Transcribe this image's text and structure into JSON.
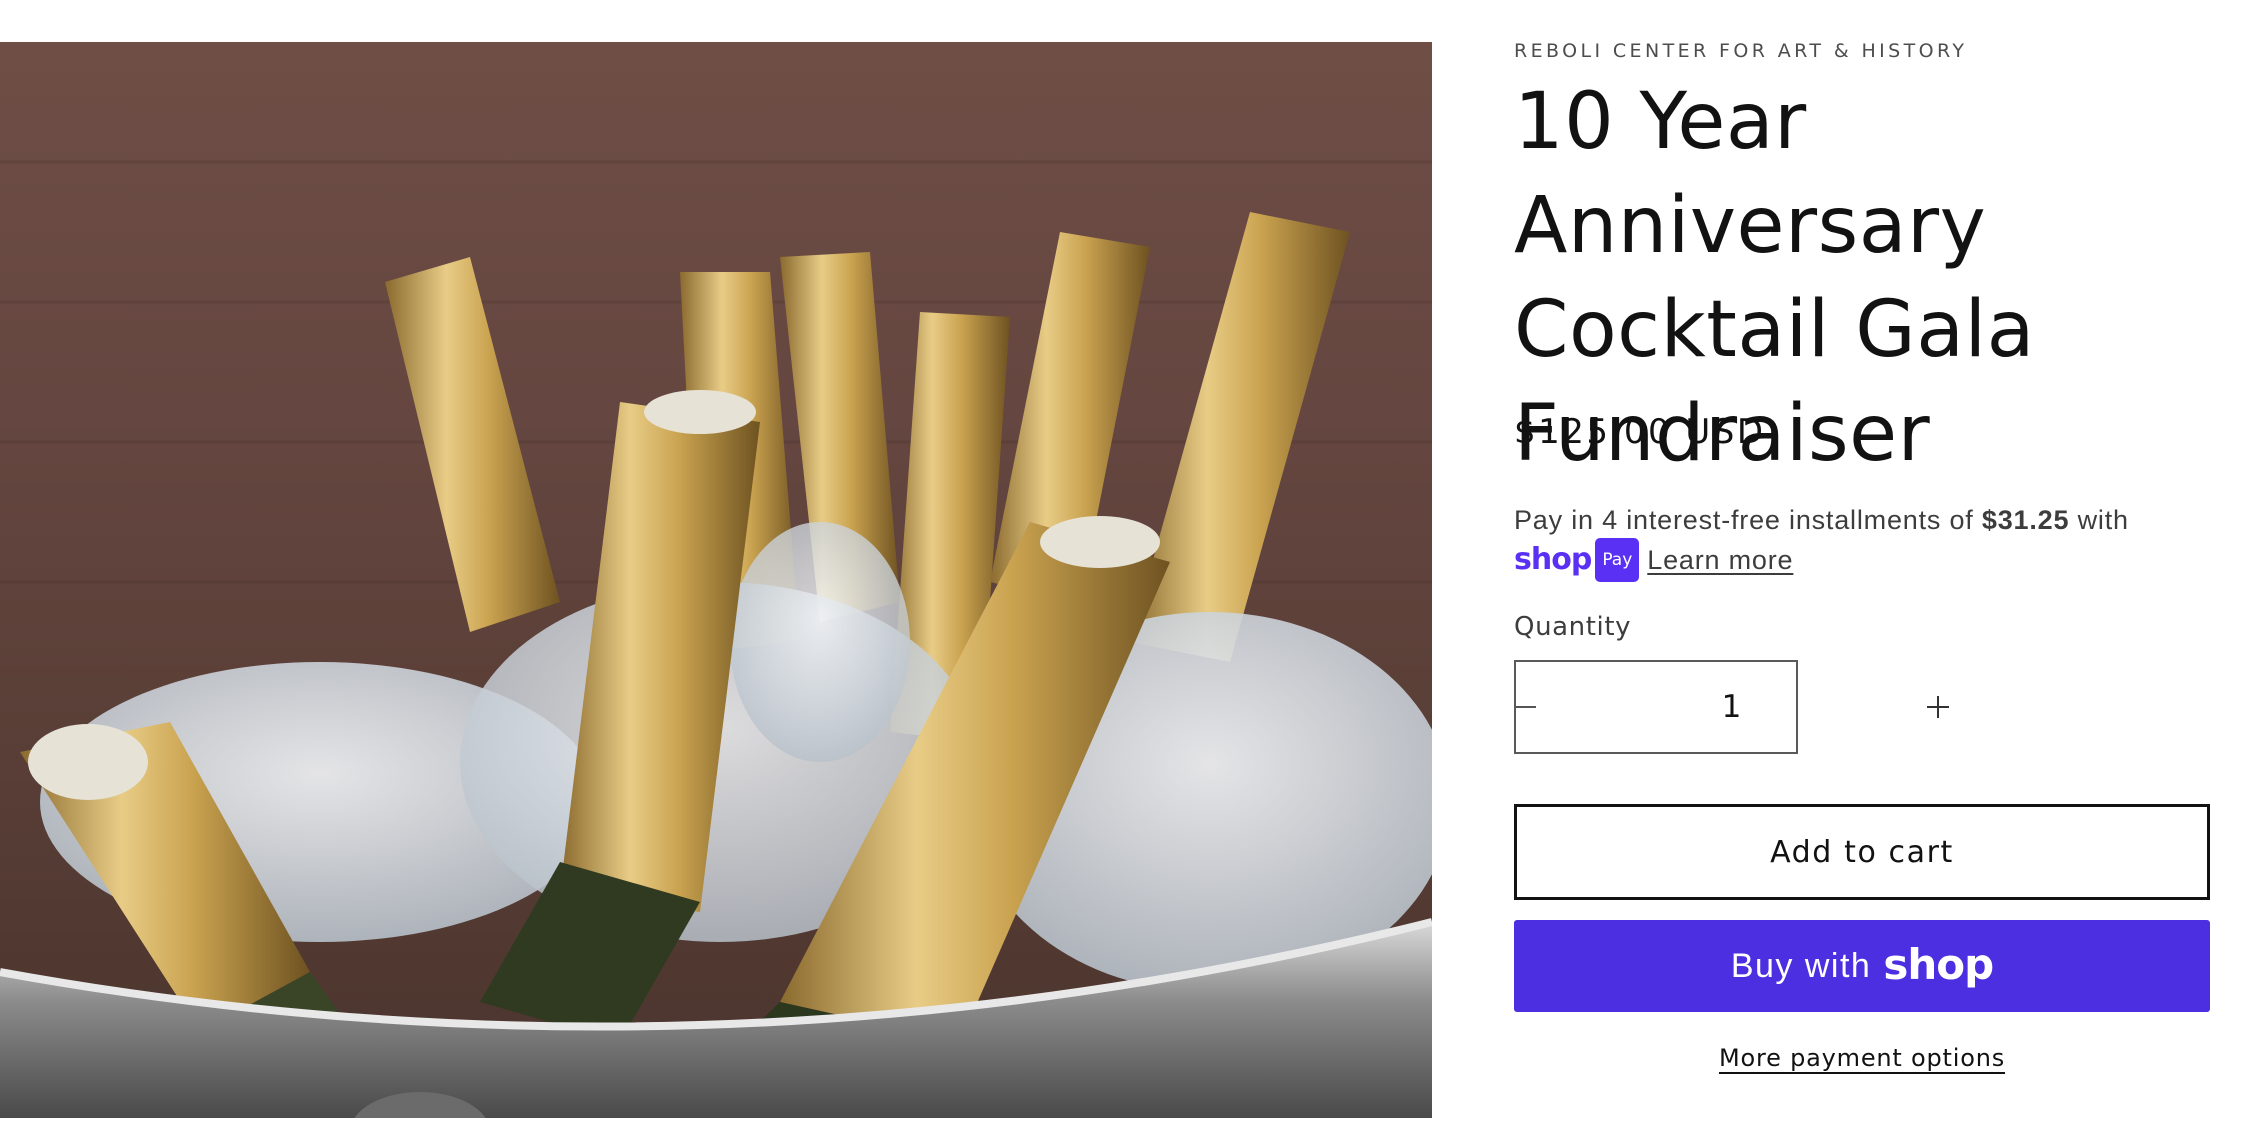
{
  "product": {
    "vendor": "REBOLI CENTER FOR ART & HISTORY",
    "title": "10 Year Anniversary Cocktail Gala Fundraiser",
    "price": "$125.00 USD",
    "image_alt": "champagne-bottles-in-ice-bucket"
  },
  "installments": {
    "prefix": "Pay in 4 interest-free installments of",
    "amount": "$31.25",
    "suffix": "with",
    "logo_text": "shop",
    "logo_badge": "Pay",
    "learn_more": "Learn more"
  },
  "quantity": {
    "label": "Quantity",
    "value": "1",
    "minus_icon": "minus-icon",
    "plus_icon": "plus-icon"
  },
  "actions": {
    "add_to_cart": "Add to cart",
    "buy_with": "Buy with",
    "buy_brand": "shop",
    "more_payment": "More payment options"
  },
  "colors": {
    "shop_pay_purple": "#5a31f4",
    "buy_button": "#4b2fe0",
    "text": "#121212"
  }
}
